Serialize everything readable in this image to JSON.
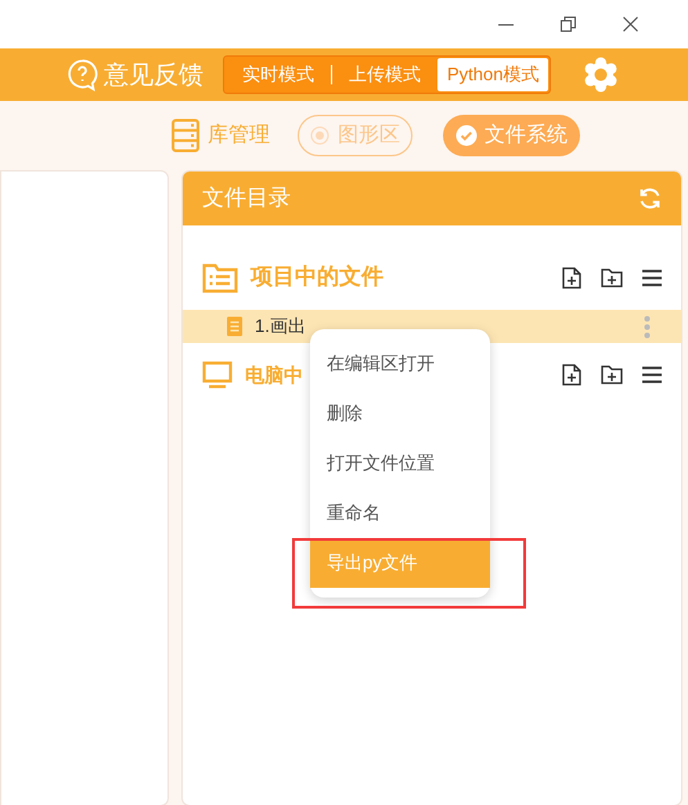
{
  "header": {
    "feedback": "意见反馈",
    "modes": [
      {
        "label": "实时模式",
        "selected": false
      },
      {
        "label": "上传模式",
        "selected": false
      },
      {
        "label": "Python模式",
        "selected": true
      }
    ]
  },
  "toolbar": [
    {
      "label": "库管理",
      "kind": "plain"
    },
    {
      "label": "图形区",
      "kind": "outline"
    },
    {
      "label": "文件系统",
      "kind": "filled"
    }
  ],
  "file_panel": {
    "title": "文件目录",
    "sections": [
      {
        "title": "项目中的文件",
        "kind": "project",
        "files": [
          {
            "name": "1.画出",
            "selected": true
          }
        ]
      },
      {
        "title": "电脑中",
        "kind": "computer"
      }
    ]
  },
  "context_menu": [
    {
      "label": "在编辑区打开",
      "selected": false,
      "highlighted": false
    },
    {
      "label": "删除",
      "selected": false,
      "highlighted": false
    },
    {
      "label": "打开文件位置",
      "selected": false,
      "highlighted": false
    },
    {
      "label": "重命名",
      "selected": false,
      "highlighted": false
    },
    {
      "label": "导出py文件",
      "selected": true,
      "highlighted": true
    }
  ]
}
